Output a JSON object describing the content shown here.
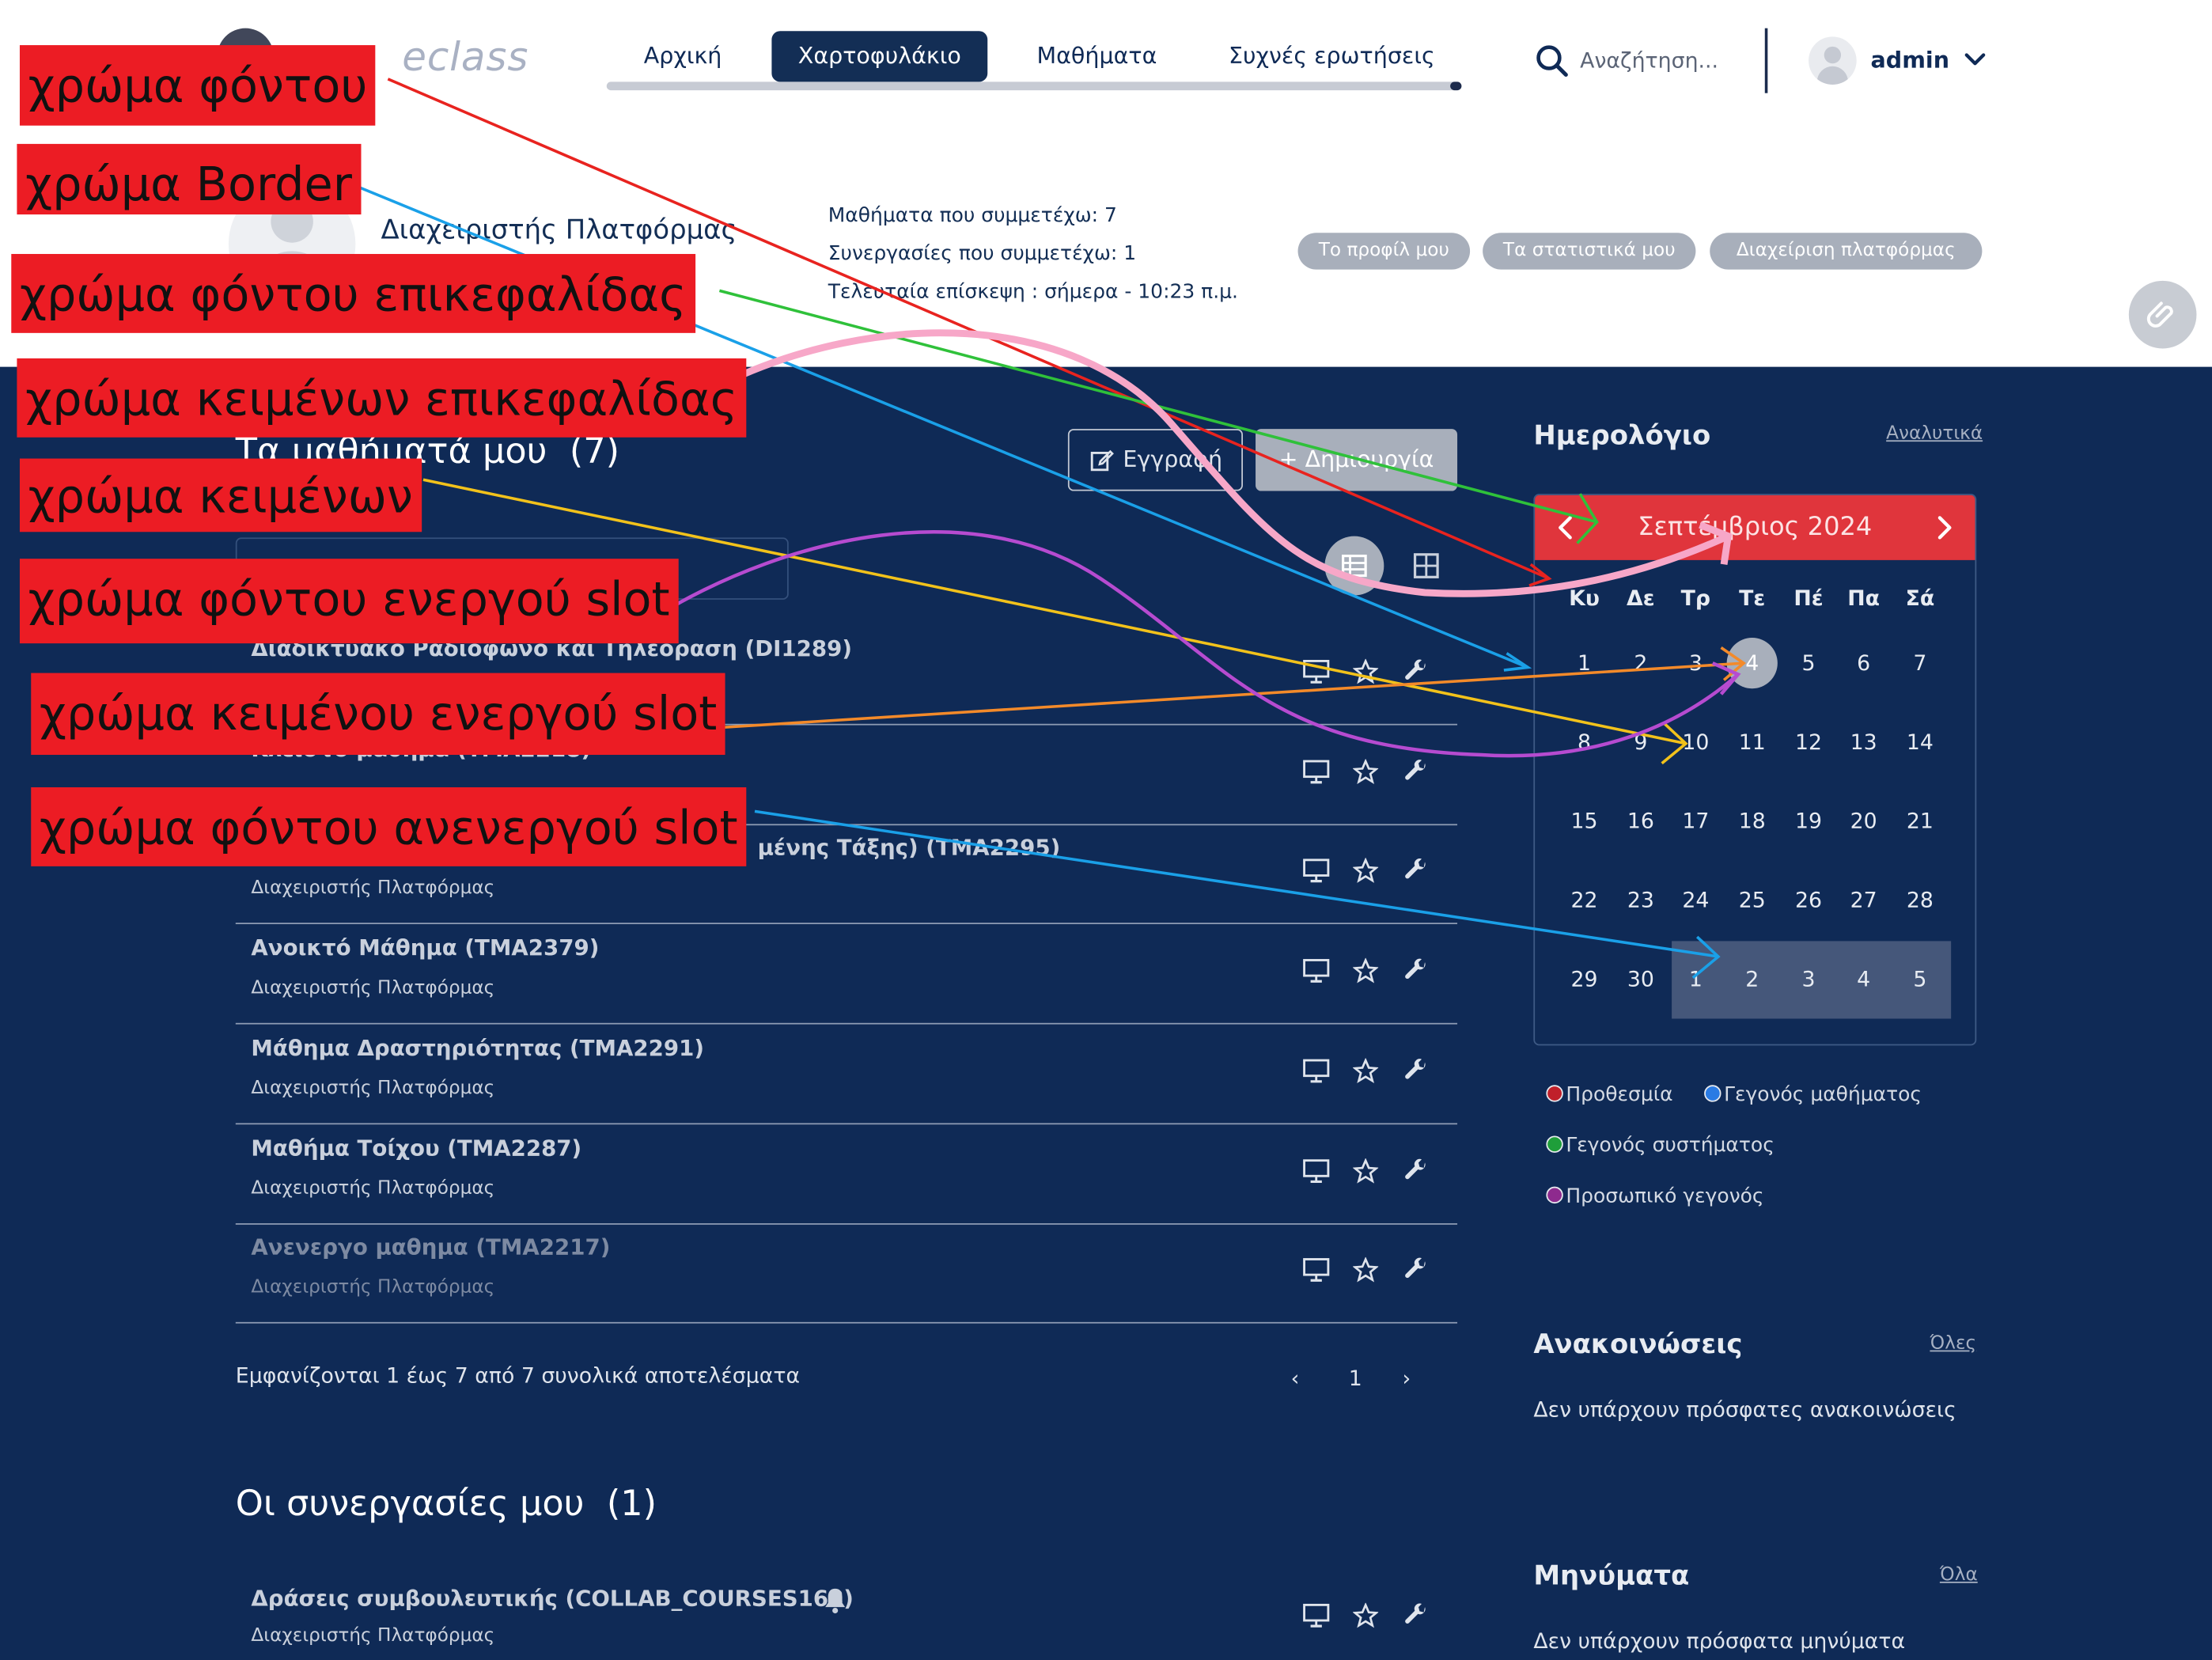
{
  "header": {
    "logo_text": "eclass",
    "nav": [
      {
        "label": "Αρχική",
        "active": false
      },
      {
        "label": "Χαρτοφυλάκιο",
        "active": true
      },
      {
        "label": "Μαθήματα",
        "active": false
      },
      {
        "label": "Συχνές ερωτήσεις",
        "active": false
      }
    ],
    "search_placeholder": "Αναζήτηση...",
    "user": "admin"
  },
  "profile": {
    "name": "Διαχειριστής Πλατφόρμας",
    "stats": [
      "Μαθήματα που συμμετέχω: 7",
      "Συνεργασίες που συμμετέχω: 1",
      "Τελευταία επίσκεψη : σήμερα - 10:23 π.μ."
    ],
    "buttons": [
      "Το προφίλ μου",
      "Τα στατιστικά μου",
      "Διαχείριση πλατφόρμας"
    ]
  },
  "courses": {
    "title": "Τα μαθήματά μου",
    "count": "(7)",
    "register_label": "Εγγραφή",
    "create_label": "+ Δημιουργία",
    "rows": [
      {
        "title": "Διαδικτυακό Ραδιόφωνο και Τηλεόραση  (DI1289)",
        "sub": "",
        "inactive": false
      },
      {
        "title": "Κλειστό μάθημα  (TMA2218)",
        "sub": "",
        "inactive": false
      },
      {
        "title": "μένης Τάξης)  (TMA2295)",
        "sub": "Διαχειριστής Πλατφόρμας",
        "inactive": false
      },
      {
        "title": "Ανοικτό Μάθημα  (TMA2379)",
        "sub": "Διαχειριστής Πλατφόρμας",
        "inactive": false
      },
      {
        "title": "Μάθημα Δραστηριότητας  (TMA2291)",
        "sub": "Διαχειριστής Πλατφόρμας",
        "inactive": false
      },
      {
        "title": "Μαθήμα Τοίχου  (TMA2287)",
        "sub": "Διαχειριστής Πλατφόρμας",
        "inactive": false
      },
      {
        "title": "Ανενεργο μαθημα  (TMA2217)",
        "sub": "Διαχειριστής Πλατφόρμας",
        "inactive": true
      }
    ],
    "pager_info": "Εμφανίζονται 1 έως 7 από 7 συνολικά αποτελέσματα",
    "pager": {
      "prev": "‹",
      "page": "1",
      "next": "›"
    }
  },
  "collabs": {
    "title": "Οι συνεργασίες μου",
    "count": "(1)",
    "rows": [
      {
        "title": "Δράσεις συμβουλευτικής  (COLLAB_COURSES168)",
        "sub": "Διαχειριστής Πλατφόρμας"
      }
    ]
  },
  "calendar": {
    "title": "Ημερολόγιο",
    "link": "Αναλυτικά",
    "month": "Σεπτέμβριος 2024",
    "weekdays": [
      "Κυ",
      "Δε",
      "Τρ",
      "Τε",
      "Πέ",
      "Πα",
      "Σά"
    ],
    "weeks": [
      [
        "1",
        "2",
        "3",
        "4",
        "5",
        "6",
        "7"
      ],
      [
        "8",
        "9",
        "10",
        "11",
        "12",
        "13",
        "14"
      ],
      [
        "15",
        "16",
        "17",
        "18",
        "19",
        "20",
        "21"
      ],
      [
        "22",
        "23",
        "24",
        "25",
        "26",
        "27",
        "28"
      ],
      [
        "29",
        "30",
        "1",
        "2",
        "3",
        "4",
        "5"
      ]
    ],
    "today": "4",
    "legend": [
      {
        "label": "Προθεσμία",
        "color": "#c0202a"
      },
      {
        "label": "Γεγονός μαθήματος",
        "color": "#2a7be4"
      },
      {
        "label": "Γεγονός συστήματος",
        "color": "#1f9e3a"
      },
      {
        "label": "Προσωπικό γεγονός",
        "color": "#8e2a8e"
      }
    ]
  },
  "announcements": {
    "title": "Ανακοινώσεις",
    "link": "Όλες",
    "empty": "Δεν υπάρχουν πρόσφατες ανακοινώσεις"
  },
  "messages": {
    "title": "Μηνύματα",
    "link": "Όλα",
    "empty": "Δεν υπάρχουν πρόσφατα μηνύματα"
  },
  "annotations": [
    {
      "label": "χρώμα φόντου",
      "color": "#e8231f"
    },
    {
      "label": "χρώμα Border",
      "color": "#1aa0e8"
    },
    {
      "label": "χρώμα φόντου επικεφαλίδας",
      "color": "#2fc13a"
    },
    {
      "label": "χρώμα κειμένων επικεφαλίδας",
      "color": "#f7a7c8"
    },
    {
      "label": "χρώμα κειμένων",
      "color": "#f2c21b"
    },
    {
      "label": "χρώμα φόντου ενεργού slot",
      "color": "#b64bd0"
    },
    {
      "label": "χρώμα κειμένου ενεργού slot",
      "color": "#f38a2a"
    },
    {
      "label": "χρώμα φόντου ανενεργού slot",
      "color": "#1aa0e8"
    }
  ]
}
